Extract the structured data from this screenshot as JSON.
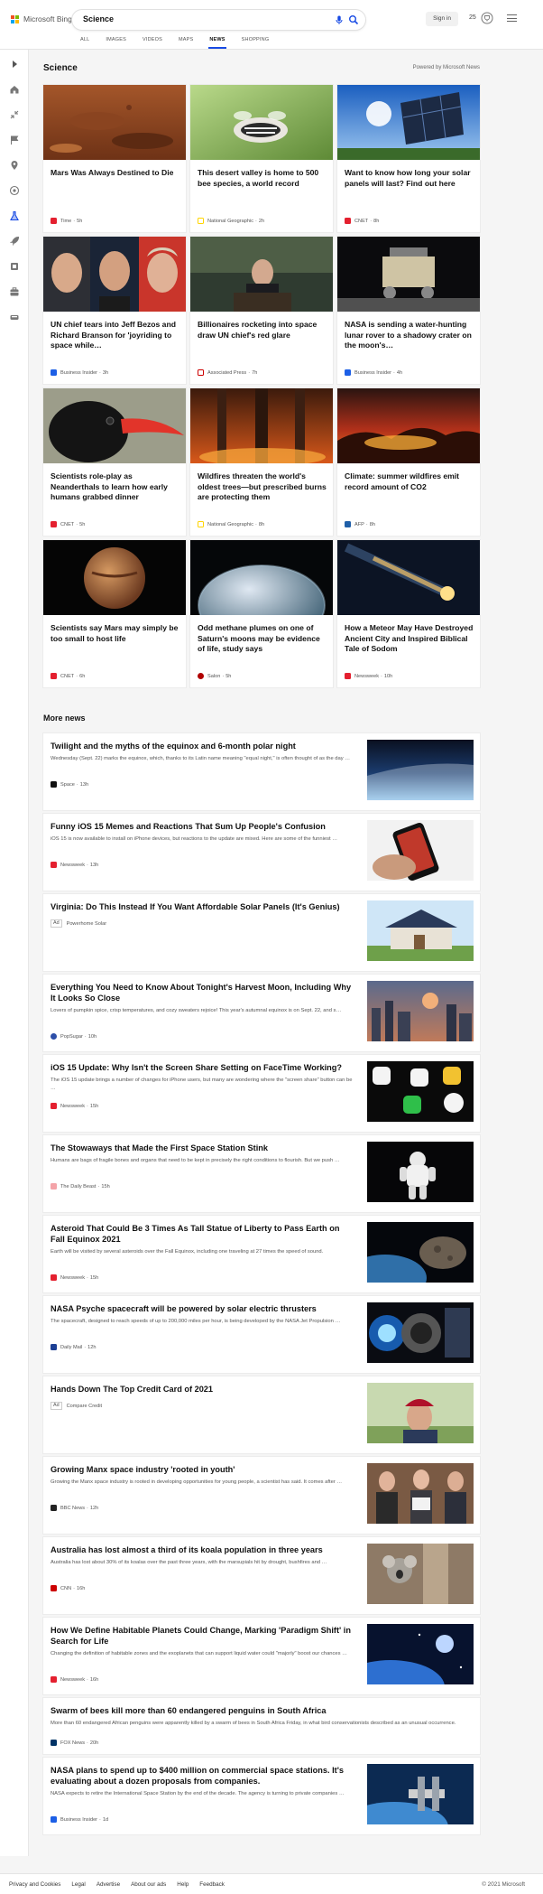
{
  "header": {
    "brand": "Microsoft Bing",
    "query": "Science",
    "signin_label": "Sign in",
    "points": "25",
    "tabs": [
      {
        "label": "ALL"
      },
      {
        "label": "IMAGES"
      },
      {
        "label": "VIDEOS"
      },
      {
        "label": "MAPS"
      },
      {
        "label": "NEWS"
      },
      {
        "label": "SHOPPING"
      }
    ],
    "active_tab": "NEWS",
    "accent_color": "#174ae4"
  },
  "sidebar": {
    "icons": [
      "expand-arrow-icon",
      "home-icon",
      "collapse-icon",
      "flag-icon",
      "location-icon",
      "globe-icon",
      "science-flask-icon",
      "rocket-icon",
      "film-icon",
      "briefcase-icon",
      "car-icon"
    ]
  },
  "section": {
    "title": "Science",
    "powered_by": "Powered by Microsoft News"
  },
  "cards": [
    {
      "title": "Mars Was Always Destined to Die",
      "source": "Time",
      "age": "5h",
      "logo_color": "#e4202f",
      "image": "mars-surface"
    },
    {
      "title": "This desert valley is home to 500 bee species, a world record",
      "source": "National Geographic",
      "age": "2h",
      "logo_color": "#ffd500",
      "image": "bee-on-flower"
    },
    {
      "title": "Want to know how long your solar panels will last? Find out here",
      "source": "CNET",
      "age": "8h",
      "logo_color": "#e4202f",
      "image": "solar-panel"
    },
    {
      "title": "UN chief tears into Jeff Bezos and Richard Branson for 'joyriding to space while…",
      "source": "Business Insider",
      "age": "3h",
      "logo_color": "#1c5fe6",
      "image": "billionaires"
    },
    {
      "title": "Billionaires rocketing into space draw UN chief's red glare",
      "source": "Associated Press",
      "age": "7h",
      "logo_color": "#c00000",
      "image": "un-podium"
    },
    {
      "title": "NASA is sending a water-hunting lunar rover to a shadowy crater on the moon's…",
      "source": "Business Insider",
      "age": "4h",
      "logo_color": "#1c5fe6",
      "image": "lunar-rover"
    },
    {
      "title": "Scientists role-play as Neanderthals to learn how early humans grabbed dinner",
      "source": "CNET",
      "age": "5h",
      "logo_color": "#e4202f",
      "image": "chough-bird"
    },
    {
      "title": "Wildfires threaten the world's oldest trees—but prescribed burns are protecting them",
      "source": "National Geographic",
      "age": "8h",
      "logo_color": "#ffd500",
      "image": "forest-fire"
    },
    {
      "title": "Climate: summer wildfires emit record amount of CO2",
      "source": "AFP",
      "age": "8h",
      "logo_color": "#1f5fa8",
      "image": "wildfire-night"
    },
    {
      "title": "Scientists say Mars may simply be too small to host life",
      "source": "CNET",
      "age": "6h",
      "logo_color": "#e4202f",
      "image": "mars-planet"
    },
    {
      "title": "Odd methane plumes on one of Saturn's moons may be evidence of life, study says",
      "source": "Salon",
      "age": "5h",
      "logo_color": "#b00000",
      "image": "enceladus"
    },
    {
      "title": "How a Meteor May Have Destroyed Ancient City and Inspired Biblical Tale of Sodom",
      "source": "Newsweek",
      "age": "10h",
      "logo_color": "#e4202f",
      "image": "meteor"
    }
  ],
  "more_news": {
    "title": "More news",
    "items": [
      {
        "title": "Twilight and the myths of the equinox and 6-month polar night",
        "desc": "Wednesday (Sept. 22) marks the equinox, which, thanks to its Latin name meaning \"equal night,\" is often thought of as the day …",
        "source": "Space",
        "age": "13h",
        "ad": false,
        "logo_color": "#111111",
        "image": "earth-horizon"
      },
      {
        "title": "Funny iOS 15 Memes and Reactions That Sum Up People's Confusion",
        "desc": "iOS 15 is now available to install on iPhone devices, but reactions to the update are mixed. Here are some of the funniest …",
        "source": "Newsweek",
        "age": "13h",
        "ad": false,
        "logo_color": "#e4202f",
        "image": "iphone-hand"
      },
      {
        "title": "Virginia: Do This Instead If You Want Affordable Solar Panels (It's Genius)",
        "desc": "",
        "source": "Powerhome Solar",
        "age": "",
        "ad": true,
        "ad_label": "Ad",
        "logo_color": "",
        "image": "solar-house"
      },
      {
        "title": "Everything You Need to Know About Tonight's Harvest Moon, Including Why It Looks So Close",
        "desc": "Lovers of pumpkin spice, crisp temperatures, and cozy sweaters rejoice! This year's autumnal equinox is on Sept. 22, and s…",
        "source": "PopSugar",
        "age": "10h",
        "ad": false,
        "logo_color": "#2d4ea8",
        "image": "harvest-moon-city"
      },
      {
        "title": "iOS 15 Update: Why Isn't the Screen Share Setting on FaceTime Working?",
        "desc": "The iOS 15 update brings a number of changes for iPhone users, but many are wondering where the \"screen share\" button can be …",
        "source": "Newsweek",
        "age": "15h",
        "ad": false,
        "logo_color": "#e4202f",
        "image": "ios-apps"
      },
      {
        "title": "The Stowaways that Made the First Space Station Stink",
        "desc": "Humans are bags of fragile bones and organs that need to be kept in precisely the right conditions to flourish. But we push …",
        "source": "The Daily Beast",
        "age": "15h",
        "ad": false,
        "logo_color": "#f4a3a8",
        "image": "astronaut"
      },
      {
        "title": "Asteroid That Could Be 3 Times As Tall Statue of Liberty to Pass Earth on Fall Equinox 2021",
        "desc": "Earth will be visited by several asteroids over the Fall Equinox, including one traveling at 27 times the speed of sound.",
        "source": "Newsweek",
        "age": "15h",
        "ad": false,
        "logo_color": "#e4202f",
        "image": "asteroid"
      },
      {
        "title": "NASA Psyche spacecraft will be powered by solar electric thrusters",
        "desc": "The spacecraft, designed to reach speeds of up to 200,000 miles per hour, is being developed by the NASA Jet Propulsion …",
        "source": "Daily Mail",
        "age": "12h",
        "ad": false,
        "logo_color": "#1c3f94",
        "image": "thruster"
      },
      {
        "title": "Hands Down The Top Credit Card of 2021",
        "desc": "",
        "source": "Compare Credit",
        "age": "",
        "ad": true,
        "ad_label": "Ad",
        "logo_color": "",
        "image": "man-cap"
      },
      {
        "title": "Growing Manx space industry 'rooted in youth'",
        "desc": "Growing the Manx space industry is rooted in developing opportunities for young people, a scientist has said. It comes after …",
        "source": "BBC News",
        "age": "12h",
        "ad": false,
        "logo_color": "#222222",
        "image": "students"
      },
      {
        "title": "Australia has lost almost a third of its koala population in three years",
        "desc": "Australia has lost about 30% of its koalas over the past three years, with the marsupials hit by drought, bushfires and …",
        "source": "CNN",
        "age": "16h",
        "ad": false,
        "logo_color": "#cc0000",
        "image": "koala"
      },
      {
        "title": "How We Define Habitable Planets Could Change, Marking 'Paradigm Shift' in Search for Life",
        "desc": "Changing the definition of habitable zones and the exoplanets that can support liquid water could \"majorly\" boost our chances …",
        "source": "Newsweek",
        "age": "16h",
        "ad": false,
        "logo_color": "#e4202f",
        "image": "planet-space"
      },
      {
        "title": "Swarm of bees kill more than 60 endangered penguins in South Africa",
        "desc": "More than 60 endangered African penguins were apparently killed by a swarm of bees in South Africa Friday, in what bird conservationists described as an unusual occurrence.",
        "source": "FOX News",
        "age": "20h",
        "ad": false,
        "logo_color": "#003366",
        "image": ""
      },
      {
        "title": "NASA plans to spend up to $400 million on commercial space stations. It's evaluating about a dozen proposals from companies.",
        "desc": "NASA expects to retire the International Space Station by the end of the decade. The agency is turning to private companies …",
        "source": "Business Insider",
        "age": "1d",
        "ad": false,
        "logo_color": "#1c5fe6",
        "image": "space-station"
      }
    ]
  },
  "footer": {
    "links": [
      "Privacy and Cookies",
      "Legal",
      "Advertise",
      "About our ads",
      "Help",
      "Feedback"
    ],
    "copyright": "© 2021 Microsoft"
  }
}
